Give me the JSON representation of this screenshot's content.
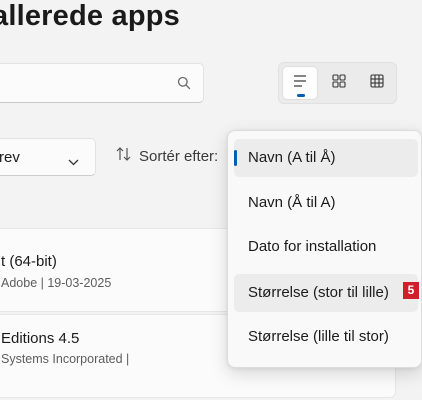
{
  "page": {
    "title": "allerede apps"
  },
  "search": {
    "value": "",
    "placeholder": "",
    "icon": "search-icon"
  },
  "view_modes": [
    {
      "name": "list-view",
      "active": true
    },
    {
      "name": "grid-view",
      "active": false
    },
    {
      "name": "table-view",
      "active": false
    }
  ],
  "filter": {
    "label": "rev"
  },
  "sort": {
    "label": "Sortér efter:"
  },
  "apps": [
    {
      "name": "t (64-bit)",
      "meta": "Adobe  |  19-03-2025"
    },
    {
      "name": "Editions 4.5",
      "meta": "Systems Incorporated  |"
    }
  ],
  "sort_menu": {
    "items": [
      {
        "label": "Navn (A til Å)",
        "selected": true
      },
      {
        "label": "Navn (Å til A)",
        "selected": false
      },
      {
        "label": "Dato for installation",
        "selected": false
      },
      {
        "label": "Størrelse (stor til lille)",
        "selected": false
      },
      {
        "label": "Størrelse (lille til stor)",
        "selected": false
      }
    ]
  },
  "badge": "5",
  "colors": {
    "accent": "#005fb8",
    "badge": "#d11f2a",
    "background": "#f3f3f3"
  }
}
